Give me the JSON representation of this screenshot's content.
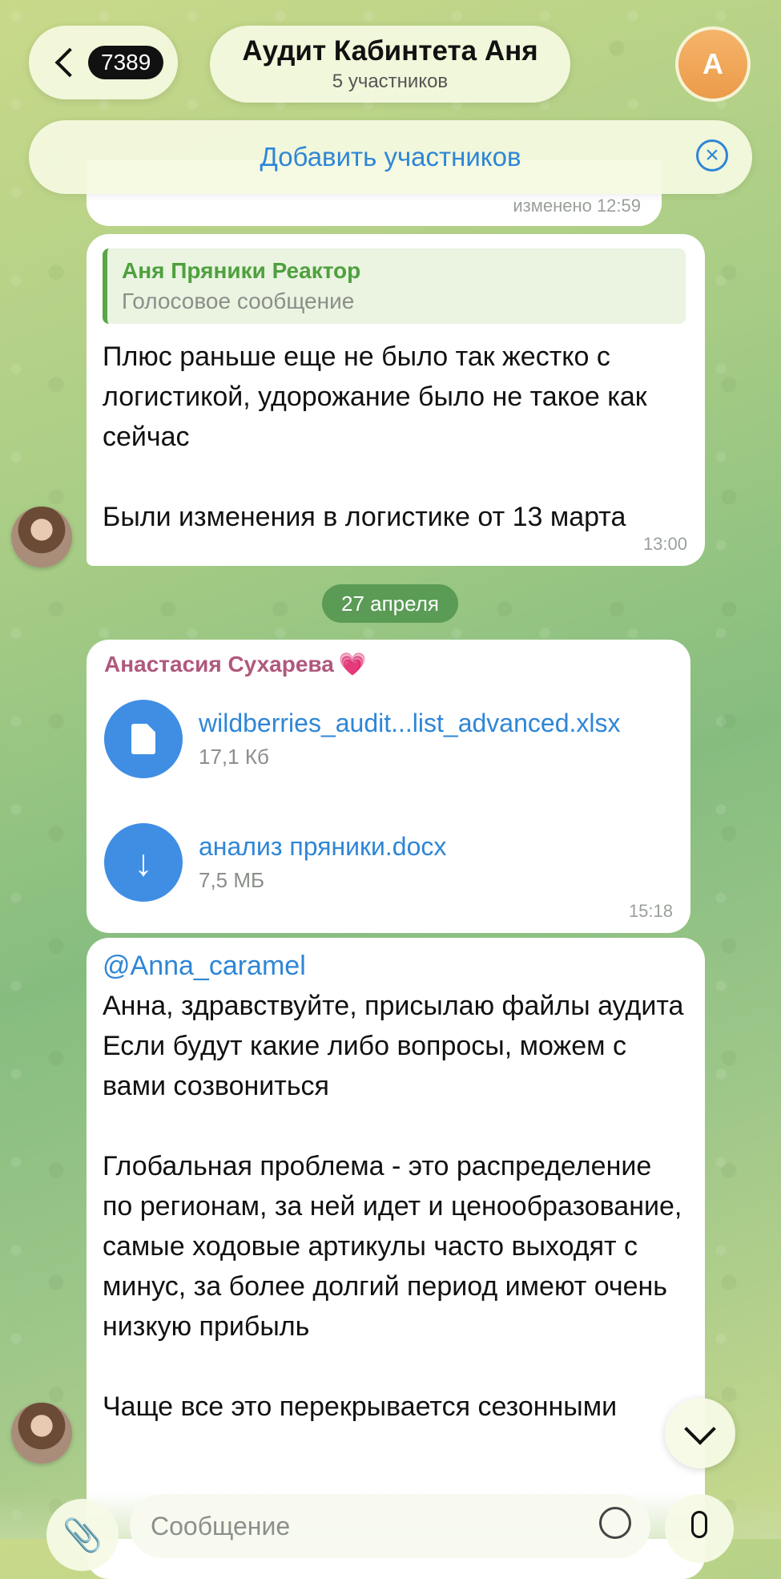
{
  "header": {
    "back_count": "7389",
    "chat_title": "Аудит Кабинтета Аня",
    "chat_subtitle": "5 участников",
    "avatar_letter": "А"
  },
  "add_members": {
    "label": "Добавить участников"
  },
  "prev_message": {
    "time": "изменено 12:59"
  },
  "message1": {
    "reply_author": "Аня Пряники Реактор",
    "reply_kind": "Голосовое сообщение",
    "text": "Плюс раньше еще не было так жестко с логистикой, удорожание было не такое как сейчас\n\nБыли изменения в логистике от 13 марта",
    "time": "13:00"
  },
  "date_separator": "27 апреля",
  "message2": {
    "sender": "Анастасия Сухарева",
    "sender_heart": "💗",
    "files": [
      {
        "name": "wildberries_audit...list_advanced.xlsx",
        "size": "17,1 Кб",
        "icon": "document-icon"
      },
      {
        "name": "анализ пряники.docx",
        "size": "7,5 МБ",
        "icon": "download-icon"
      }
    ],
    "time": "15:18"
  },
  "message3": {
    "mention": "@Anna_caramel",
    "text": "Анна, здравствуйте, присылаю файлы аудита\nЕсли будут какие либо вопросы, можем с вами созвониться\n\nГлобальная проблема - это распределение по регионам, за ней идет и ценообразование, самые ходовые артикулы часто выходят с минус, за более долгий период имеют очень низкую прибыль\n\nЧаще все это перекрывается сезонными"
  },
  "composer": {
    "placeholder": "Сообщение"
  }
}
